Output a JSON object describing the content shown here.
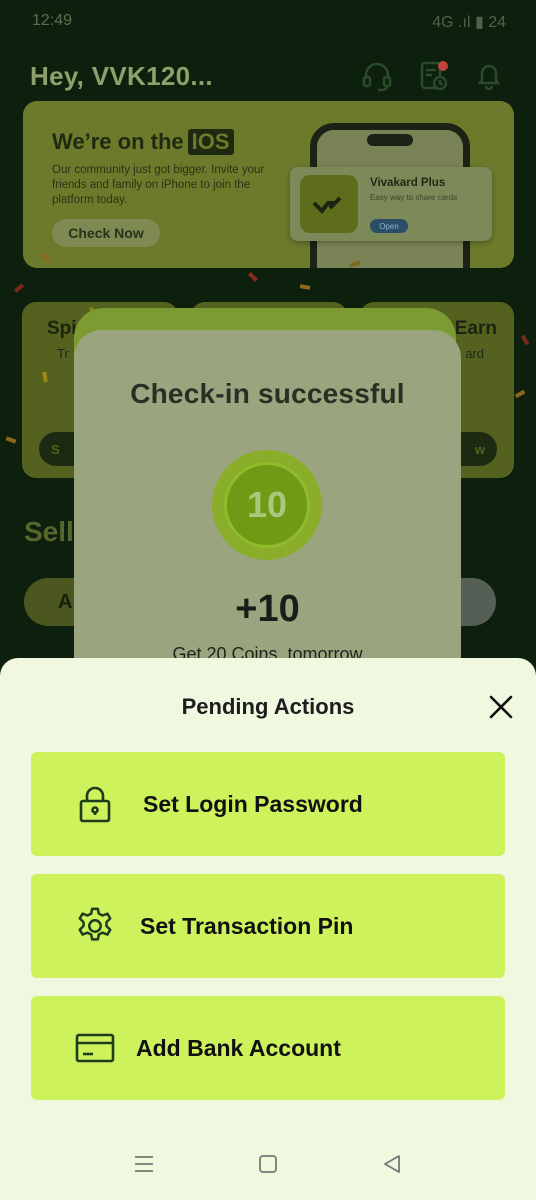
{
  "status_bar": {
    "time": "12:49",
    "extra": "••",
    "right": "4G  .ıl  ▮  24"
  },
  "header": {
    "greeting": "Hey, VVK120..."
  },
  "promo": {
    "title_prefix": "We’re on the",
    "title_tag": "IOS",
    "description": "Our community just got bigger. Invite your friends and family on iPhone to join the platform today.",
    "cta": "Check Now",
    "app_name": "Vivakard Plus",
    "app_subtitle": "Easy way to share cards",
    "app_open": "Open"
  },
  "features": [
    {
      "title": "Spi",
      "subtitle": "Tr",
      "button": "S"
    },
    {
      "title": "",
      "subtitle": "",
      "button": ""
    },
    {
      "title": "Earn",
      "subtitle": "ard",
      "button": "w"
    }
  ],
  "section": {
    "title": "Sell",
    "pill_left": "A"
  },
  "checkin": {
    "title": "Check-in successful",
    "coin_value": "10",
    "reward": "+10",
    "next": "Get 20 Coins, tomorrow"
  },
  "sheet": {
    "title": "Pending Actions",
    "actions": [
      {
        "label": "Set Login Password",
        "icon": "lock-icon"
      },
      {
        "label": "Set Transaction Pin",
        "icon": "gear-icon"
      },
      {
        "label": "Add Bank Account",
        "icon": "card-icon"
      }
    ]
  },
  "colors": {
    "accent": "#cdf25c",
    "sheet_bg": "#f0f8df",
    "app_bg": "#0d200d"
  }
}
